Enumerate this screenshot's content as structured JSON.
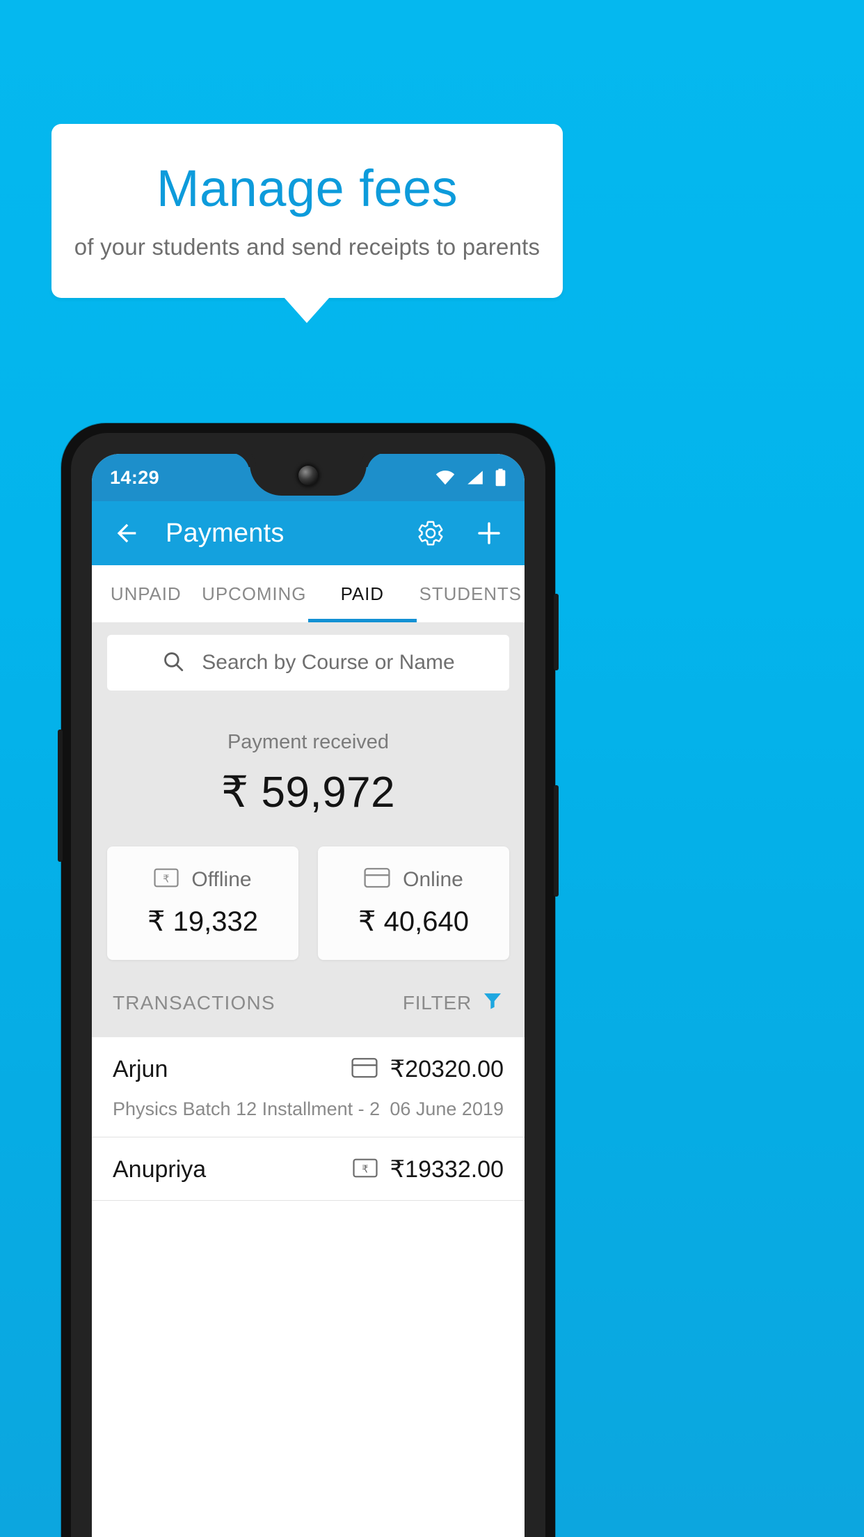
{
  "promo": {
    "title": "Manage fees",
    "subtitle": "of your students and send receipts to parents",
    "accent_color": "#0D9BDB",
    "background_color": "#00B6ED",
    "card_color": "#FFFFFF"
  },
  "phone": {
    "statusbar": {
      "time": "14:29",
      "icons": [
        "wifi-icon",
        "signal-icon",
        "battery-icon"
      ],
      "background_color": "#1D8FCB"
    },
    "appbar": {
      "back_icon": "back-arrow-icon",
      "title": "Payments",
      "settings_icon": "gear-icon",
      "add_icon": "plus-icon",
      "background_color": "#14A1DE"
    },
    "tabs": [
      {
        "label": "UNPAID",
        "active": false
      },
      {
        "label": "UPCOMING",
        "active": false
      },
      {
        "label": "PAID",
        "active": true
      },
      {
        "label": "STUDENTS",
        "active": false
      }
    ],
    "tab_indicator_color": "#1391D4",
    "search": {
      "icon": "search-icon",
      "placeholder": "Search by Course or Name",
      "value": ""
    },
    "summary": {
      "label": "Payment received",
      "amount": "₹ 59,972"
    },
    "methods": [
      {
        "icon": "rupee-note-icon",
        "label": "Offline",
        "amount": "₹ 19,332"
      },
      {
        "icon": "credit-card-icon",
        "label": "Online",
        "amount": "₹ 40,640"
      }
    ],
    "transactions_header": {
      "title": "TRANSACTIONS",
      "filter_label": "FILTER",
      "filter_icon": "funnel-icon",
      "filter_icon_color": "#1EA7E0"
    },
    "transactions": [
      {
        "name": "Arjun",
        "description": "Physics Batch 12 Installment - 2",
        "amount": "₹20320.00",
        "date": "06 June 2019",
        "method_icon": "credit-card-icon"
      },
      {
        "name": "Anupriya",
        "description": "",
        "amount": "₹19332.00",
        "date": "",
        "method_icon": "rupee-note-icon"
      }
    ]
  }
}
